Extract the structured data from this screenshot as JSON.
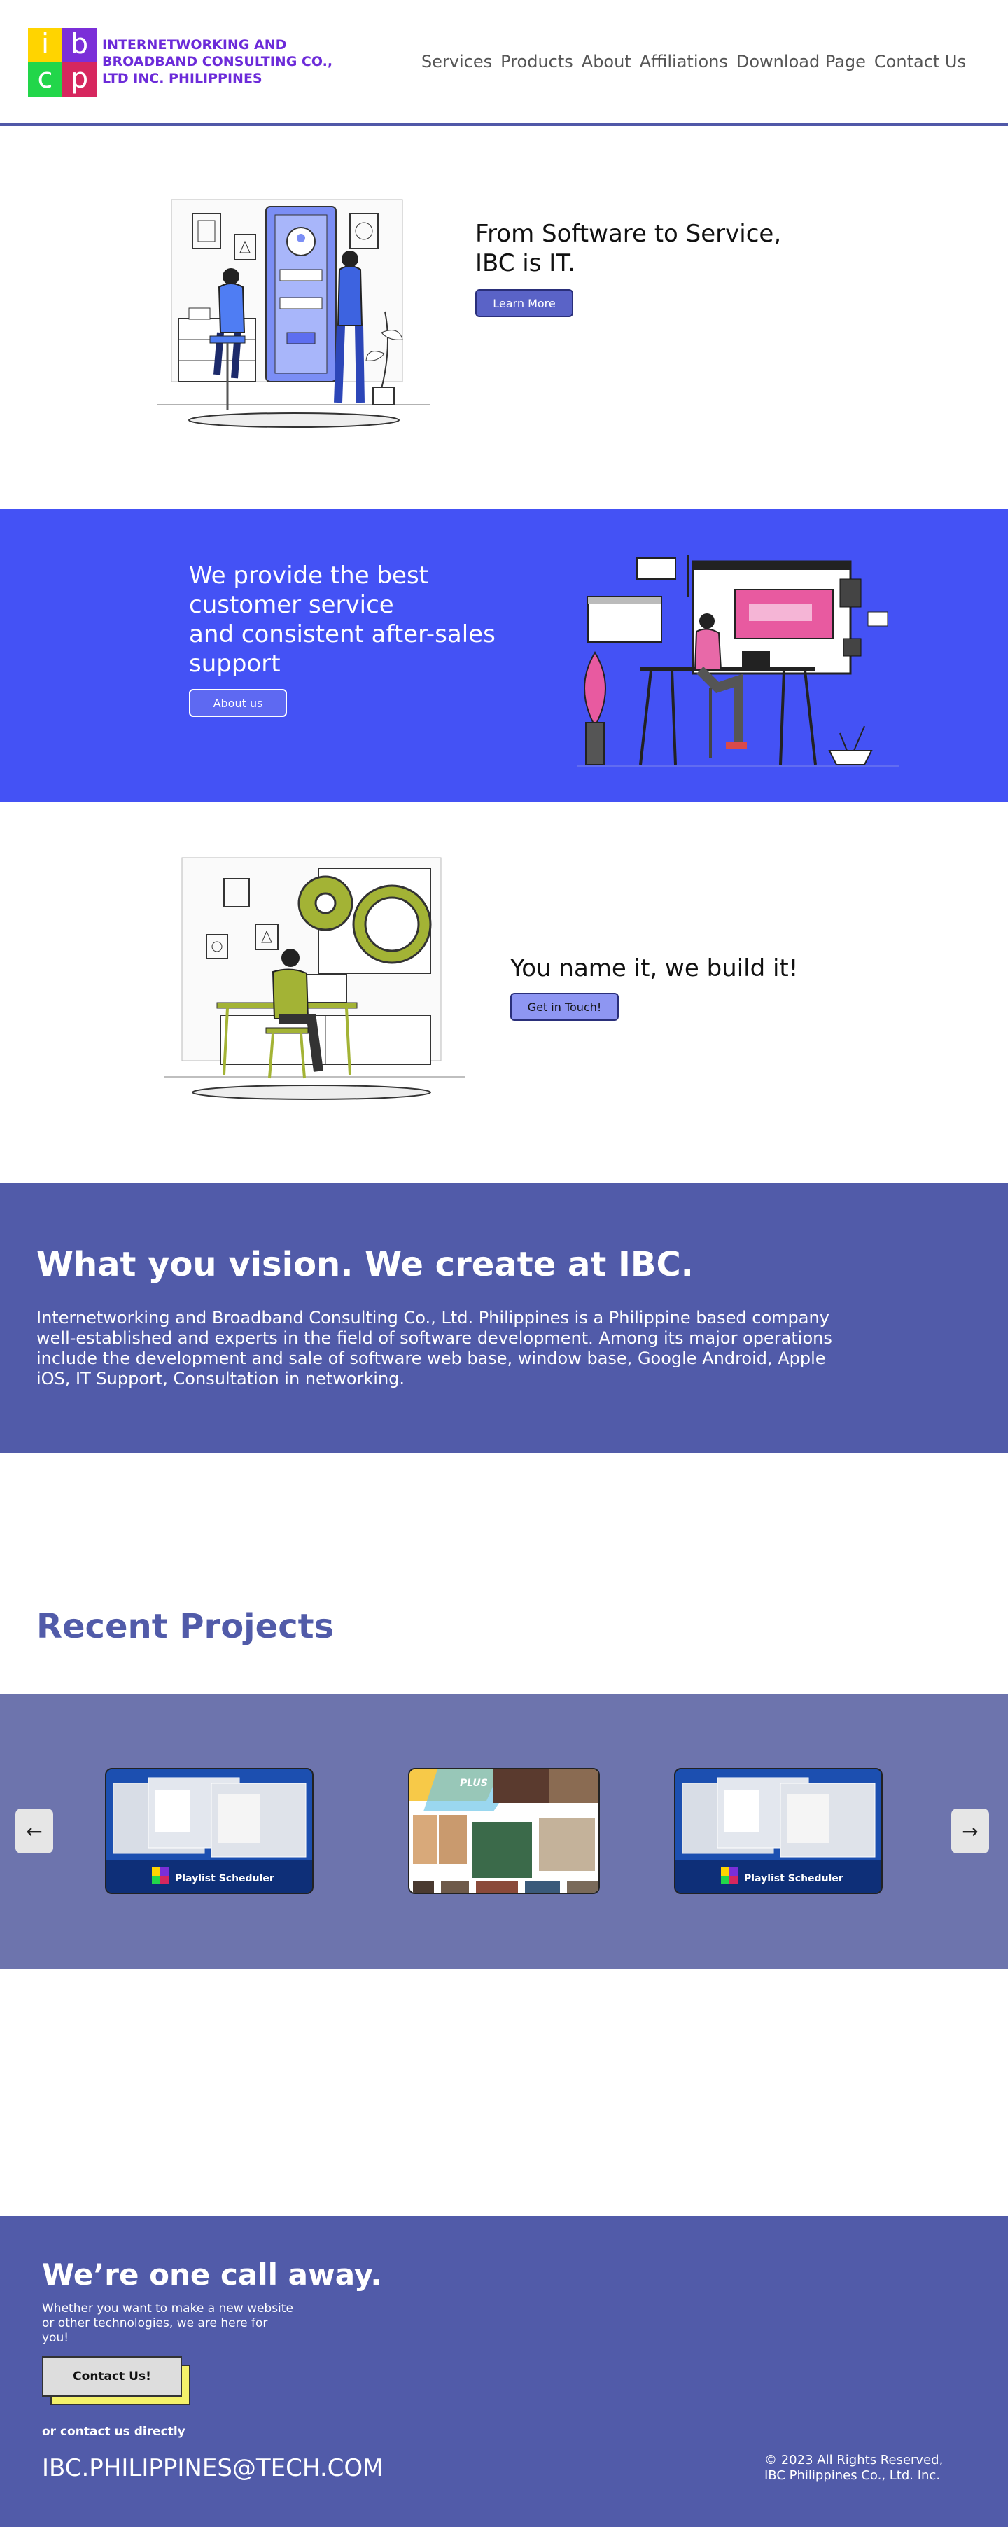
{
  "header": {
    "logo_letters": [
      "i",
      "b",
      "c",
      "p"
    ],
    "logo_colors": [
      "#ffd400",
      "#7b2fd8",
      "#22d64a",
      "#d6275e"
    ],
    "company_name_lines": [
      "INTERNETWORKING AND",
      "BROADBAND CONSULTING CO.,",
      "LTD INC. PHILIPPINES"
    ],
    "nav": [
      "Services",
      "Products",
      "About",
      "Affiliations",
      "Download Page",
      "Contact Us"
    ]
  },
  "hero1": {
    "title_lines": [
      "From Software to Service,",
      "IBC is IT."
    ],
    "button": "Learn More"
  },
  "hero2": {
    "title_lines": [
      "We provide the best",
      "customer service",
      "and consistent after-sales",
      "support"
    ],
    "button": "About us"
  },
  "hero3": {
    "title": "You name it, we build it!",
    "button": "Get in Touch!"
  },
  "about": {
    "heading": "What you vision. We create at IBC.",
    "body": "Internetworking and Broadband Consulting Co., Ltd. Philippines is a Philippine based company well-established and experts in the field of software development. Among its major operations include the development and sale of software web base, window base, Google Android, Apple iOS, IT Support, Consultation in networking."
  },
  "projects": {
    "heading": "Recent Projects",
    "slides": [
      {
        "caption": "Playlist Scheduler",
        "logo": "ibcp"
      },
      {
        "caption": "PLUS",
        "logo": ""
      },
      {
        "caption": "Playlist Scheduler",
        "logo": "ibcp"
      }
    ]
  },
  "footer": {
    "heading": "We’re one call away.",
    "text": "Whether you want to make a new website or other technologies, we are here for you!",
    "button": "Contact Us!",
    "direct_label": "or contact us directly",
    "email": "IBC.PHILIPPINES@TECH.COM",
    "copyright_lines": [
      "© 2023 All Rights Reserved,",
      "IBC Philippines Co., Ltd. Inc."
    ]
  },
  "colors": {
    "accent": "#515ba9",
    "hero_blue": "#4452f5",
    "carousel_bg": "#6d74ad",
    "brand_purple": "#6c2bd9"
  }
}
